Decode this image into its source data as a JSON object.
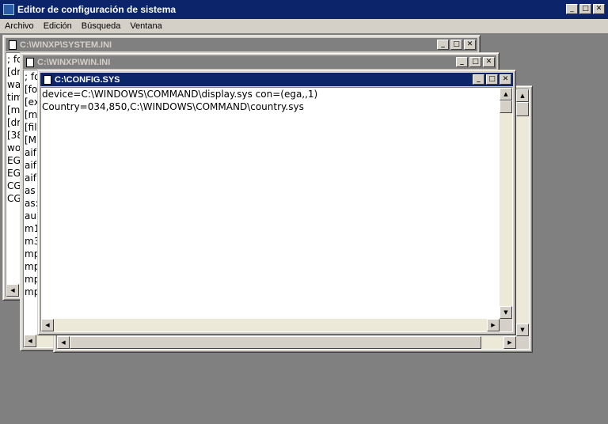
{
  "app": {
    "title": "Editor de configuración de sistema"
  },
  "titlebar_buttons": {
    "minimize": "_",
    "maximize": "□",
    "close": "✕"
  },
  "menu": [
    "Archivo",
    "Edición",
    "Búsqueda",
    "Ventana"
  ],
  "windows": {
    "system_ini": {
      "title": "C:\\WINXP\\SYSTEM.INI",
      "lines": [
        "; fo",
        "[dr",
        "wa",
        "tim",
        "[m",
        "[dr",
        "[38",
        "wo",
        "EG",
        "EG",
        "CG",
        "CG"
      ]
    },
    "win_ini": {
      "title": "C:\\WINXP\\WIN.INI",
      "lines": [
        "; fo",
        "[fo",
        "[ex",
        "[m",
        "[fil",
        "[M",
        "aif",
        "aif",
        "aif",
        "as",
        "as:",
        "au",
        "m1",
        "m3",
        "mp",
        "mp",
        "mp",
        "mp"
      ]
    },
    "config_sys": {
      "title": "C:\\CONFIG.SYS",
      "lines": [
        "device=C:\\WINDOWS\\COMMAND\\display.sys con=(ega,,1)",
        "Country=034,850,C:\\WINDOWS\\COMMAND\\country.sys"
      ]
    }
  },
  "colors": {
    "active_title": "#0b246a",
    "inactive_title": "#808080",
    "mdi_background": "#808080",
    "chrome": "#d4d0c8"
  }
}
